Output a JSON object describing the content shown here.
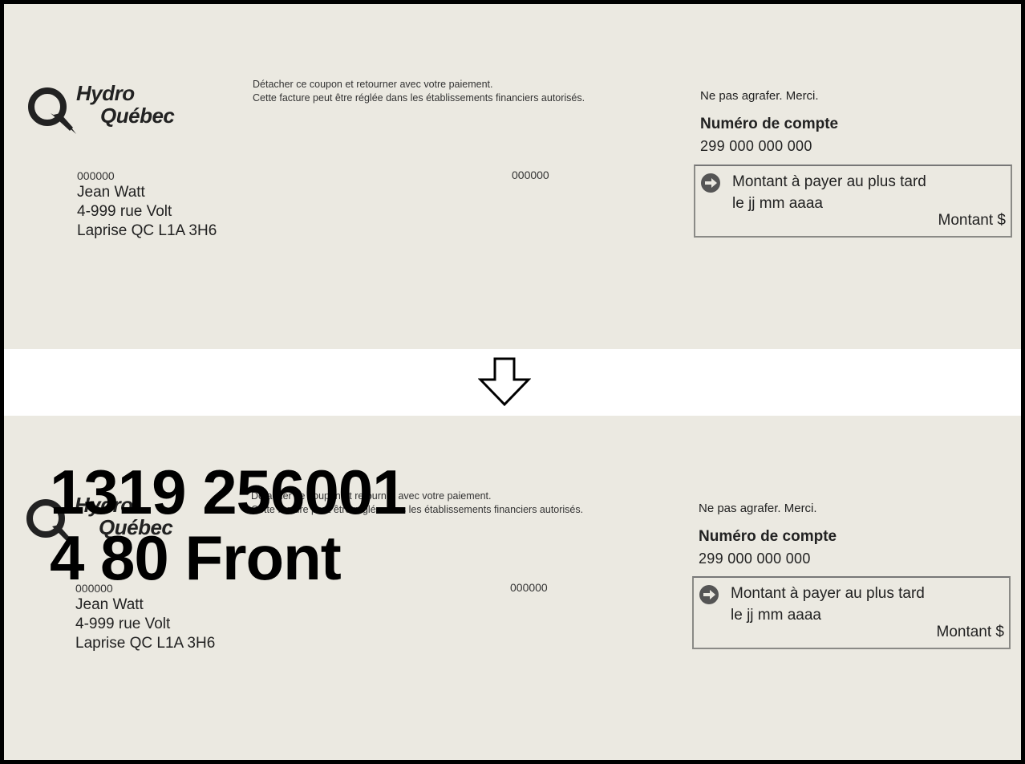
{
  "coupon": {
    "brand_line1": "Hydro",
    "brand_line2": "Québec",
    "instruction_line1": "Détacher ce coupon et retourner avec votre paiement.",
    "instruction_line2": "Cette facture peut être réglée dans les établissements financiers autorisés.",
    "address_code": "000000",
    "customer_name": "Jean Watt",
    "street": "4-999 rue Volt",
    "city_line": "Laprise QC  L1A 3H6",
    "mid_code": "000000",
    "no_staple": "Ne pas agrafer. Merci.",
    "account_label": "Numéro de compte",
    "account_number": "299 000 000 000",
    "pay_label_line1": "Montant à payer au plus tard",
    "pay_label_line2": "le jj mm aaaa",
    "amount_label": "Montant $"
  },
  "overlay": {
    "line1": "1319 256001",
    "line2": "4 80 Front"
  }
}
